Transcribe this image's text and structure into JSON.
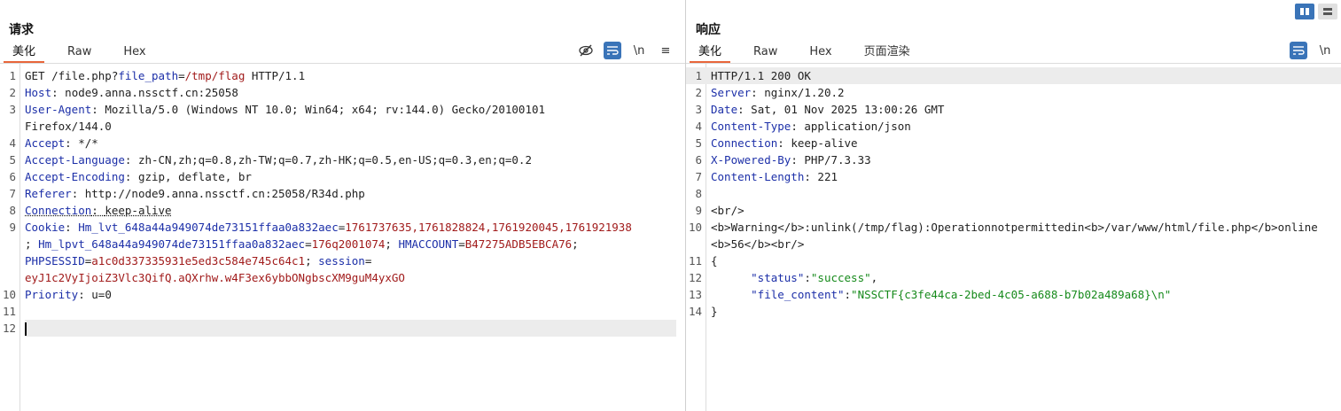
{
  "request": {
    "title": "请求",
    "tabs": [
      "美化",
      "Raw",
      "Hex"
    ],
    "toolbar": {
      "hide_icon": "eye-slash",
      "wrap_icon": "wrap-lines",
      "newline": "\\n",
      "menu_icon": "≡"
    },
    "lines": [
      {
        "n": "1",
        "method": "GET /file.php?",
        "param_key": "file_path",
        "eq": "=",
        "param_val": "/tmp/flag",
        "proto": " HTTP/1.1"
      },
      {
        "n": "2",
        "key": "Host",
        "value": "node9.anna.nssctf.cn:25058"
      },
      {
        "n": "3",
        "key": "User-Agent",
        "value": "Mozilla/5.0 (Windows NT 10.0; Win64; x64; rv:144.0) Gecko/20100101",
        "cont": "Firefox/144.0"
      },
      {
        "n": "4",
        "key": "Accept",
        "value": "*/*"
      },
      {
        "n": "5",
        "key": "Accept-Language",
        "value": "zh-CN,zh;q=0.8,zh-TW;q=0.7,zh-HK;q=0.5,en-US;q=0.3,en;q=0.2"
      },
      {
        "n": "6",
        "key": "Accept-Encoding",
        "value": "gzip, deflate, br"
      },
      {
        "n": "7",
        "key": "Referer",
        "value": "http://node9.anna.nssctf.cn:25058/R34d.php"
      },
      {
        "n": "8",
        "key": "Connection",
        "value": "keep-alive"
      },
      {
        "n": "9",
        "key": "Cookie",
        "c1k": "Hm_lvt_648a44a949074de73151ffaa0a832aec",
        "c1v": "1761737635,1761828824,1761920045,1761921938",
        "c2k": "Hm_lpvt_648a44a949074de73151ffaa0a832aec",
        "c2v": "176q2001074",
        "c3k": "HMACCOUNT",
        "c3v": "B47275ADB5EBCA76",
        "c4k": "PHPSESSID",
        "c4v": "a1c0d337335931e5ed3c584e745c64c1",
        "c5k": "session",
        "c5v": "eyJ1c2VyIjoiZ3Vlc3QifQ.aQXrhw.w4F3ex6ybbONgbscXM9guM4yxGO"
      },
      {
        "n": "10",
        "key": "Priority",
        "value": "u=0"
      },
      {
        "n": "11"
      },
      {
        "n": "12"
      }
    ]
  },
  "response": {
    "title": "响应",
    "tabs": [
      "美化",
      "Raw",
      "Hex",
      "页面渲染"
    ],
    "toolbar": {
      "wrap_icon": "wrap-lines",
      "newline": "\\n"
    },
    "lines": [
      {
        "n": "1",
        "text": "HTTP/1.1 200 OK"
      },
      {
        "n": "2",
        "key": "Server",
        "value": "nginx/1.20.2"
      },
      {
        "n": "3",
        "key": "Date",
        "value": "Sat, 01 Nov 2025 13:00:26 GMT"
      },
      {
        "n": "4",
        "key": "Content-Type",
        "value": "application/json"
      },
      {
        "n": "5",
        "key": "Connection",
        "value": "keep-alive"
      },
      {
        "n": "6",
        "key": "X-Powered-By",
        "value": "PHP/7.3.33"
      },
      {
        "n": "7",
        "key": "Content-Length",
        "value": "221"
      },
      {
        "n": "8"
      },
      {
        "n": "9",
        "text": "<br/>"
      },
      {
        "n": "10",
        "text": "<b>Warning</b>:unlink(/tmp/flag):Operationnotpermittedin<b>/var/www/html/file.php</b>online",
        "cont": "<b>56</b><br/>"
      },
      {
        "n": "11",
        "text": "{"
      },
      {
        "n": "12",
        "jk": "\"status\"",
        "colon": ":",
        "jv": "\"success\"",
        "tail": ","
      },
      {
        "n": "13",
        "jk": "\"file_content\"",
        "colon": ":",
        "jv": "\"NSSCTF{c3fe44ca-2bed-4c05-a688-b7b02a489a68}\\n\""
      },
      {
        "n": "14",
        "text": "}"
      }
    ]
  },
  "layout_toggle": {
    "split_icon": "columns-icon",
    "stack_icon": "rows-icon"
  }
}
